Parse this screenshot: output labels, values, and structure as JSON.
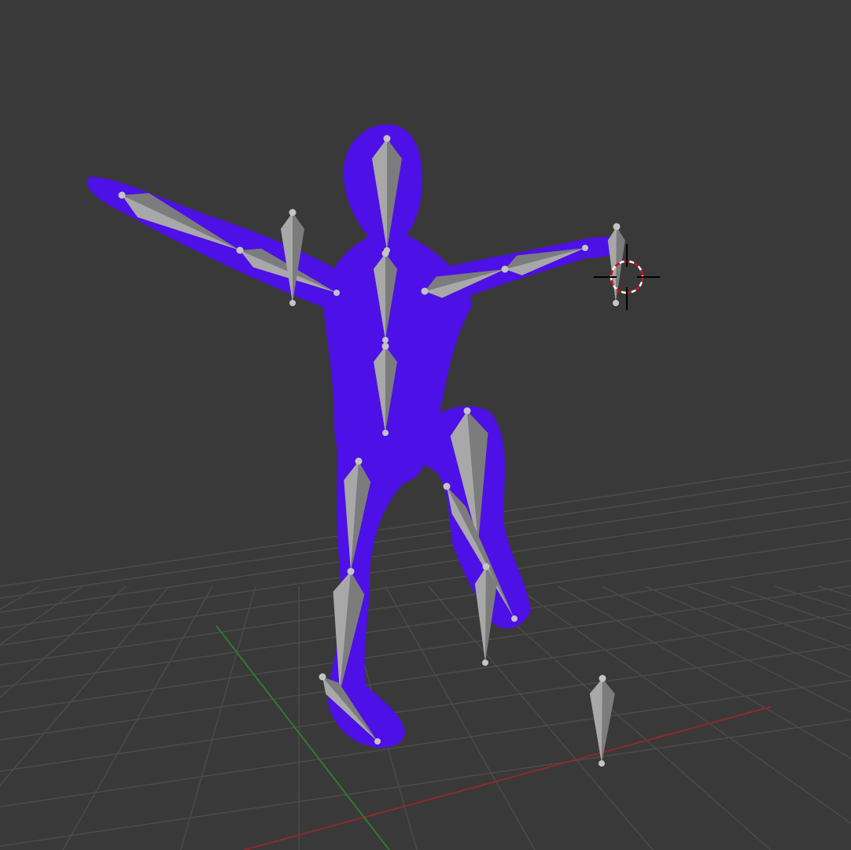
{
  "viewport": {
    "name": "3D Viewport",
    "background_color": "#393939",
    "grid_color": "#4a4a4a",
    "x_axis_color": "#8a2a2a",
    "y_axis_color": "#2f7a2f"
  },
  "scene": {
    "mesh": {
      "name": "character-mesh",
      "color": "#4d10e6"
    },
    "armature": {
      "name": "armature",
      "bone_color": "#a8a8a8",
      "bone_shade_color": "#7c7c7c",
      "joint_color": "#c4c4c4"
    },
    "cursor": {
      "name": "3d-cursor",
      "ring_colors": [
        "#d01010",
        "#ffffff"
      ]
    }
  }
}
